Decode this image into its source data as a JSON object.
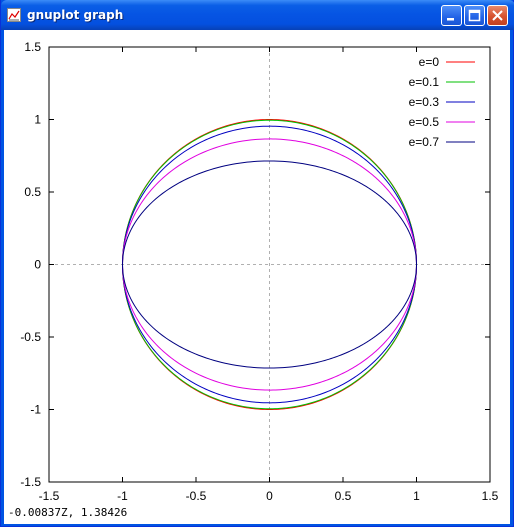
{
  "window": {
    "title": "gnuplot graph"
  },
  "status_readout": "-0.00837Z,  1.38426",
  "chart_data": {
    "type": "line",
    "xlim": [
      -1.5,
      1.5
    ],
    "ylim": [
      -1.5,
      1.5
    ],
    "x_ticks": [
      "-1.5",
      "-1",
      "-0.5",
      "0",
      "0.5",
      "1",
      "1.5"
    ],
    "y_ticks": [
      "1.5",
      "1",
      "0.5",
      "0",
      "-0.5",
      "-1",
      "-1.5"
    ],
    "x_tick_values": [
      -1.5,
      -1,
      -0.5,
      0,
      0.5,
      1,
      1.5
    ],
    "y_tick_values": [
      1.5,
      1,
      0.5,
      0,
      -0.5,
      -1,
      -1.5
    ],
    "zero_axes_dashed": true,
    "legend_position": "top-right",
    "series": [
      {
        "name": "e=0",
        "e": 0.0,
        "color": "#ff0000"
      },
      {
        "name": "e=0.1",
        "e": 0.1,
        "color": "#00c000"
      },
      {
        "name": "e=0.3",
        "e": 0.3,
        "color": "#0000c0"
      },
      {
        "name": "e=0.5",
        "e": 0.5,
        "color": "#e000e0"
      },
      {
        "name": "e=0.7",
        "e": 0.7,
        "color": "#000080"
      }
    ]
  }
}
